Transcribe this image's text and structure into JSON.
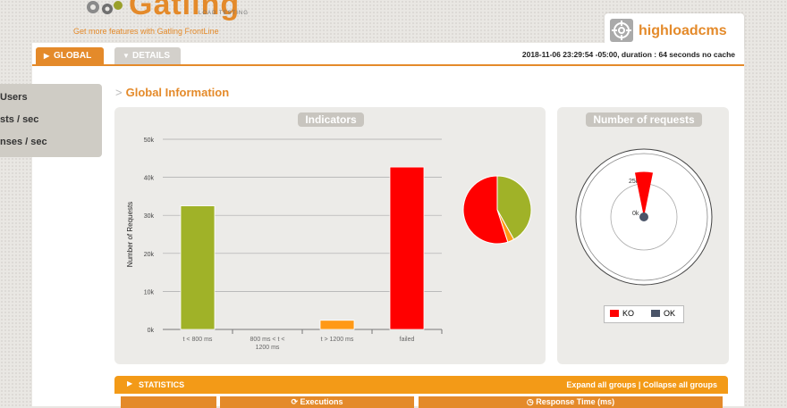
{
  "header": {
    "logo_text": "Gatling",
    "logo_subtext": "LOAD TESTING",
    "frontline_link": "Get more features with Gatling FrontLine",
    "simulation_name": "highloadcms"
  },
  "tabs": [
    {
      "label": "GLOBAL",
      "active": true
    },
    {
      "label": "DETAILS",
      "active": false
    }
  ],
  "run_info": "2018-11-06 23:29:54 -05:00, duration : 64 seconds no cache",
  "sidebar": {
    "items": [
      {
        "label": "Users"
      },
      {
        "label": "sts / sec"
      },
      {
        "label": "nses / sec"
      }
    ]
  },
  "section": {
    "arrow": ">",
    "title": "Global Information"
  },
  "indicators_panel": {
    "title": "Indicators"
  },
  "requests_panel": {
    "title": "Number of requests"
  },
  "chart_data": [
    {
      "type": "bar",
      "title": "Indicators",
      "ylabel": "Number of Requests",
      "xlabel": "",
      "categories": [
        "t < 800 ms",
        "800 ms < t < 1200 ms",
        "t > 1200 ms",
        "failed"
      ],
      "values": [
        32500,
        0,
        2400,
        42700
      ],
      "colors": [
        "#a0b228",
        "#ffdd00",
        "#ff9916",
        "#ff0000"
      ],
      "ylim": [
        0,
        50000
      ],
      "yticks": [
        "0k",
        "10k",
        "20k",
        "30k",
        "40k",
        "50k"
      ],
      "grid": true
    },
    {
      "type": "pie",
      "values": [
        32500,
        0,
        2400,
        42700
      ],
      "colors": [
        "#a0b228",
        "#ffdd00",
        "#ff9916",
        "#ff0000"
      ]
    },
    {
      "type": "polar",
      "title": "Number of requests",
      "ring_labels": [
        "0k",
        "25k"
      ],
      "series": [
        {
          "name": "KO",
          "color": "#ff0000",
          "value": 42700
        },
        {
          "name": "OK",
          "color": "#4a5468",
          "value": 0
        }
      ]
    }
  ],
  "legend": {
    "ko": "KO",
    "ok": "OK"
  },
  "statistics": {
    "title": "STATISTICS",
    "expand_link": "Expand all groups",
    "separator": "|",
    "collapse_link": "Collapse all groups",
    "columns": [
      "",
      "Executions",
      "Response Time (ms)"
    ]
  }
}
